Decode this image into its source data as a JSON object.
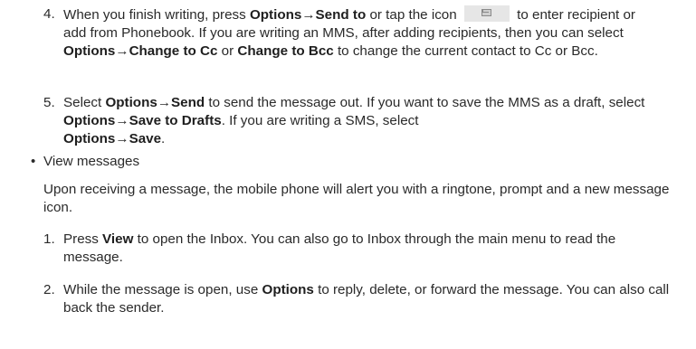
{
  "step4": {
    "num": "4.",
    "t1": "When you finish writing, press ",
    "b1": "Options",
    "arrow": "→",
    "b2": "Send to",
    "t2": " or tap the icon ",
    "icon": "envelope-icon",
    "t3": " to enter recipient or add from Phonebook. If you are writing an MMS, after adding recipients, then you can select ",
    "b3": "Options",
    "b4": "Change to Cc",
    "t4": " or ",
    "b5": "Change to Bcc",
    "t5": " to change the current contact to Cc or Bcc."
  },
  "step5": {
    "num": "5.",
    "t1": "Select ",
    "b1": "Options",
    "b2": "Send",
    "t2": " to send the message out. If you want to save the MMS as a draft, select ",
    "b3": "Options",
    "b4": "Save to Drafts",
    "t3": ". If you are writing a SMS, select ",
    "b5": "Options",
    "b6": "Save",
    "t4": "."
  },
  "view": {
    "bullet": "•",
    "heading": "View messages",
    "intro": "Upon receiving a message, the mobile phone will alert you with a ringtone, prompt and a new message icon."
  },
  "step1": {
    "num": "1.",
    "t1": "Press ",
    "b1": "View",
    "t2": " to open the Inbox. You can also go to Inbox through the main menu to read the message."
  },
  "step2": {
    "num": "2.",
    "t1": "While the message is open, use ",
    "b1": "Options",
    "t2": " to reply, delete, or forward the message. You can also call back the sender."
  }
}
